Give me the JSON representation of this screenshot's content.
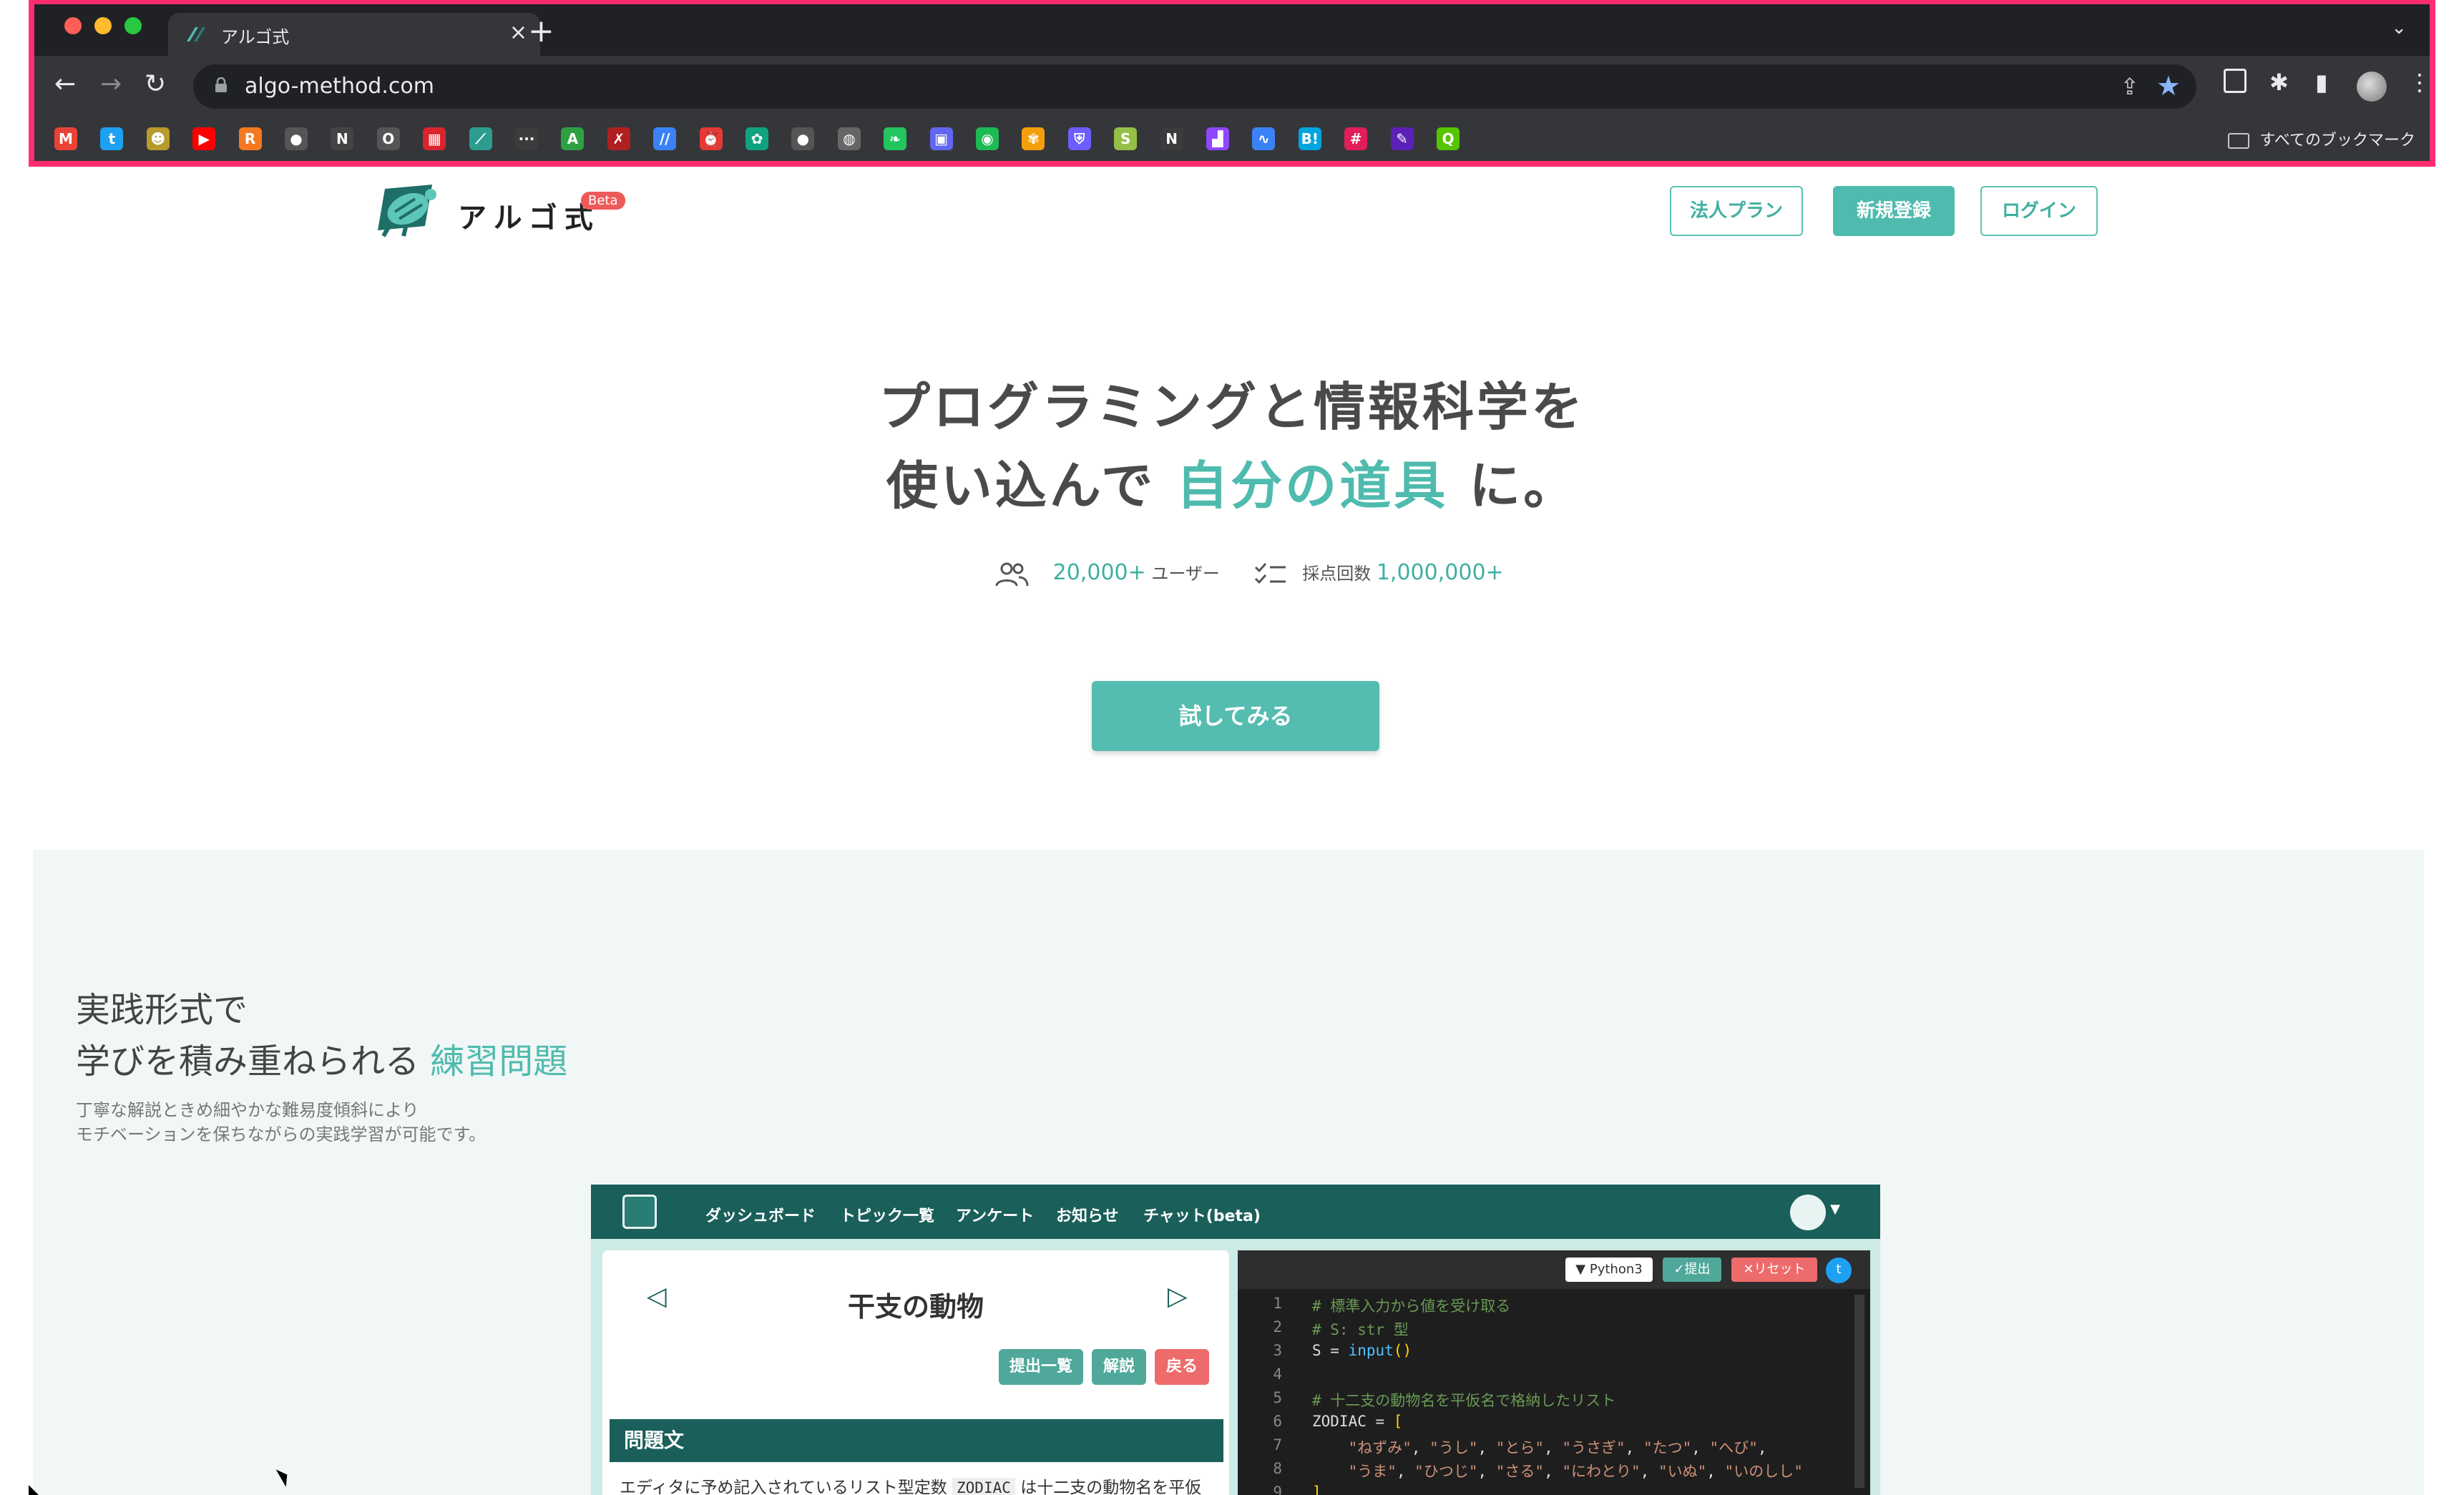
{
  "browser": {
    "tab_title": "アルゴ式",
    "close_glyph": "×",
    "new_tab_glyph": "+",
    "tab_menu_glyph": "⌄",
    "back_glyph": "←",
    "forward_glyph": "→",
    "reload_glyph": "↻",
    "url": "algo-method.com",
    "share_glyph": "⇪",
    "star_glyph": "★",
    "extensions_glyph": "✱",
    "sidepanel_glyph": "▮",
    "menu_glyph": "⋮",
    "bookmarks_folder": "すべてのブックマーク",
    "bookmark_icons": [
      {
        "name": "gmail-icon",
        "glyph": "M",
        "color": "#ea4335"
      },
      {
        "name": "twitter-icon",
        "glyph": "t",
        "color": "#1da1f2"
      },
      {
        "name": "mascot-icon",
        "glyph": "☻",
        "color": "#b79b2c"
      },
      {
        "name": "youtube-icon",
        "glyph": "▶",
        "color": "#ff0000"
      },
      {
        "name": "r-icon",
        "glyph": "R",
        "color": "#f47920"
      },
      {
        "name": "github-icon",
        "glyph": "●",
        "color": "#555555"
      },
      {
        "name": "notion-icon",
        "glyph": "N",
        "color": "#444444"
      },
      {
        "name": "o-icon",
        "glyph": "O",
        "color": "#555555"
      },
      {
        "name": "news-icon",
        "glyph": "▦",
        "color": "#d9232d"
      },
      {
        "name": "algo-icon",
        "glyph": "⟋",
        "color": "#2a9d8f"
      },
      {
        "name": "dots-icon",
        "glyph": "···",
        "color": "#3c3c3c"
      },
      {
        "name": "atcoder-icon",
        "glyph": "A",
        "color": "#2ea043"
      },
      {
        "name": "x-icon",
        "glyph": "✗",
        "color": "#b02020"
      },
      {
        "name": "slash-icon",
        "glyph": "//",
        "color": "#3b82f6"
      },
      {
        "name": "alarm-icon",
        "glyph": "⏰",
        "color": "#e53935"
      },
      {
        "name": "chatgpt-icon",
        "glyph": "✿",
        "color": "#10a37f"
      },
      {
        "name": "github2-icon",
        "glyph": "●",
        "color": "#555555"
      },
      {
        "name": "globe-icon",
        "glyph": "◍",
        "color": "#666666"
      },
      {
        "name": "leaf-icon",
        "glyph": "❧",
        "color": "#22c55e"
      },
      {
        "name": "cube-icon",
        "glyph": "▣",
        "color": "#6366f1"
      },
      {
        "name": "spotify-icon",
        "glyph": "◉",
        "color": "#1db954"
      },
      {
        "name": "flower-icon",
        "glyph": "✾",
        "color": "#f59e0b"
      },
      {
        "name": "shield-icon",
        "glyph": "⛨",
        "color": "#6d5dfc"
      },
      {
        "name": "shopify-icon",
        "glyph": "S",
        "color": "#95bf47"
      },
      {
        "name": "n-icon",
        "glyph": "N",
        "color": "#3c3c3c"
      },
      {
        "name": "twitch-icon",
        "glyph": "▟",
        "color": "#9146ff"
      },
      {
        "name": "wave-icon",
        "glyph": "∿",
        "color": "#3b82f6"
      },
      {
        "name": "hatena-icon",
        "glyph": "B!",
        "color": "#00a4de"
      },
      {
        "name": "slack-icon",
        "glyph": "#",
        "color": "#e01e5a"
      },
      {
        "name": "feather-icon",
        "glyph": "✎",
        "color": "#5b21b6"
      },
      {
        "name": "qiita-icon",
        "glyph": "Q",
        "color": "#55c500"
      }
    ]
  },
  "site": {
    "logo_text": "アルゴ式",
    "logo_badge": "Beta",
    "nav": {
      "corporate": "法人プラン",
      "signup": "新規登録",
      "login": "ログイン"
    }
  },
  "hero": {
    "line1": "プログラミングと情報科学を",
    "line2_pre": "使い込んで",
    "line2_accent": "自分の道具",
    "line2_post": "に。",
    "users_count": "20,000+",
    "users_label": "ユーザー",
    "grading_label": "採点回数",
    "grading_count": "1,000,000+",
    "cta": "試してみる"
  },
  "feature": {
    "heading_line1": "実践形式で",
    "heading_line2_pre": "学びを積み重ねられる",
    "heading_line2_accent": "練習問題",
    "desc_line1": "丁寧な解説ときめ細やかな難易度傾斜により",
    "desc_line2": "モチベーションを保ちながらの実践学習が可能です。"
  },
  "app": {
    "nav": [
      "ダッシュボード",
      "トピック一覧",
      "アンケート",
      "お知らせ",
      "チャット(beta)"
    ],
    "prev_glyph": "◁",
    "next_glyph": "▷",
    "problem_title": "干支の動物",
    "btn_submissions": "提出一覧",
    "btn_explanation": "解説",
    "btn_back": "戻る",
    "section_heading": "問題文",
    "problem_text_pre": "エディタに予め記入されているリスト型定数",
    "problem_text_code": "ZODIAC",
    "problem_text_post": "は十二支の動物名を平仮",
    "editor_lang": "▼ Python3",
    "editor_submit": "✓提出",
    "editor_reset": "✕リセット",
    "editor_share": "t",
    "code_lines": [
      {
        "n": "1",
        "text": "# 標準入力から値を受け取る"
      },
      {
        "n": "2",
        "text": "# S: str 型"
      },
      {
        "n": "3",
        "text": "S = input()"
      },
      {
        "n": "4",
        "text": ""
      },
      {
        "n": "5",
        "text": "# 十二支の動物名を平仮名で格納したリスト"
      },
      {
        "n": "6",
        "text": "ZODIAC = ["
      },
      {
        "n": "7",
        "text": "    \"ねずみ\", \"うし\", \"とら\", \"うさぎ\", \"たつ\", \"へび\","
      },
      {
        "n": "8",
        "text": "    \"うま\", \"ひつじ\", \"さる\", \"にわとり\", \"いぬ\", \"いのしし\""
      },
      {
        "n": "9",
        "text": "]"
      }
    ]
  },
  "colors": {
    "accent": "#4fbbae",
    "dark_teal": "#1a5f5a",
    "danger": "#ee6b6b",
    "highlight_frame": "#ff2d6f"
  }
}
